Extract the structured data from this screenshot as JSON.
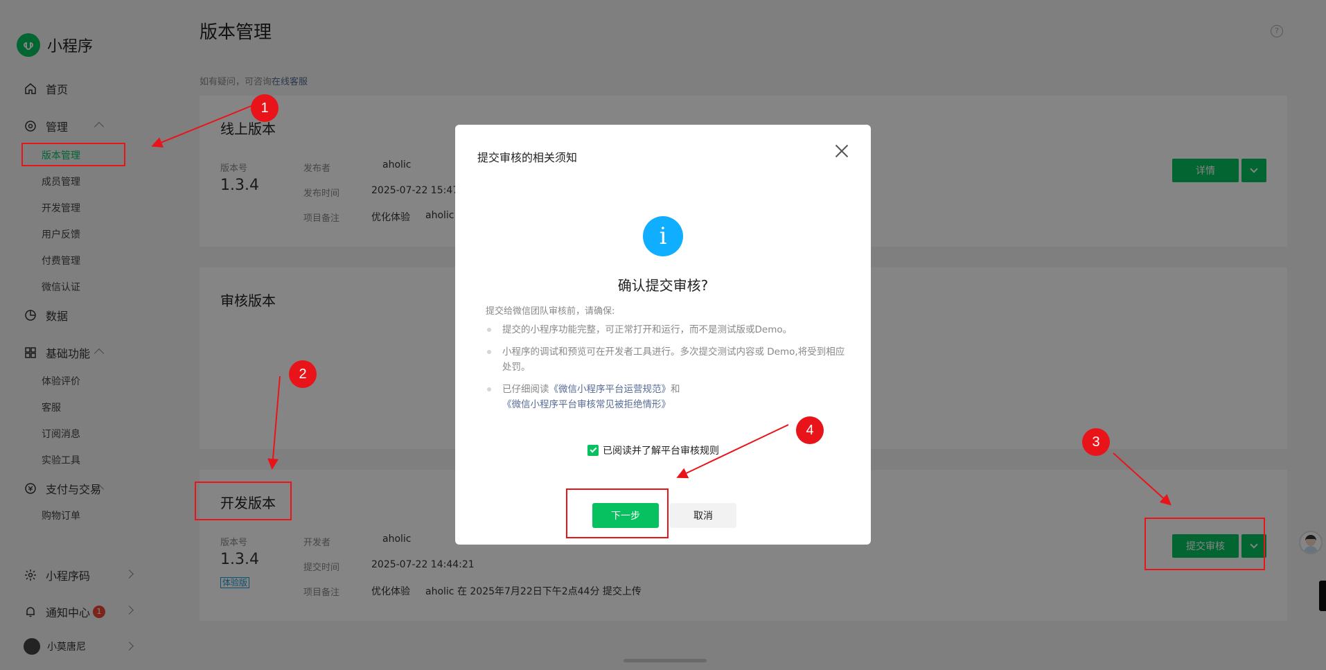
{
  "app": {
    "name": "小程序"
  },
  "sidebar": {
    "home": "首页",
    "manage": {
      "label": "管理",
      "items": [
        "版本管理",
        "成员管理",
        "开发管理",
        "用户反馈",
        "付费管理",
        "微信认证"
      ]
    },
    "data": "数据",
    "basic": {
      "label": "基础功能",
      "items": [
        "体验评价",
        "客服",
        "订阅消息",
        "实验工具"
      ]
    },
    "pay": {
      "label": "支付与交易",
      "items": [
        "购物订单"
      ]
    },
    "qrcode": "小程序码",
    "notify": {
      "label": "通知中心",
      "count": "1"
    },
    "user": "小莫唐尼"
  },
  "page": {
    "title": "版本管理",
    "hint_prefix": "如有疑问，可咨询",
    "hint_link": "在线客服"
  },
  "online": {
    "title": "线上版本",
    "version_label": "版本号",
    "version": "1.3.4",
    "publisher_label": "发布者",
    "publisher": "aholic",
    "time_label": "发布时间",
    "time": "2025-07-22 15:47:",
    "note_label": "项目备注",
    "note": "优化体验",
    "note_by": "aholic",
    "detail_btn": "详情"
  },
  "review": {
    "title": "审核版本"
  },
  "dev": {
    "title": "开发版本",
    "version_label": "版本号",
    "version": "1.3.4",
    "tag": "体验版",
    "dev_label": "开发者",
    "developer": "aholic",
    "time_label": "提交时间",
    "time": "2025-07-22 14:44:21",
    "note_label": "项目备注",
    "note": "优化体验",
    "note_detail": "aholic 在 2025年7月22日下午2点44分 提交上传",
    "submit_btn": "提交审核"
  },
  "modal": {
    "title": "提交审核的相关须知",
    "heading": "确认提交审核?",
    "intro": "提交给微信团队审核前，请确保:",
    "rule1": "提交的小程序功能完整，可正常打开和运行，而不是测试版或Demo。",
    "rule2": "小程序的调试和预览可在开发者工具进行。多次提交测试内容或 Demo,将受到相应处罚。",
    "rule3_prefix": "已仔细阅读",
    "rule3_link1": "《微信小程序平台运营规范》",
    "rule3_and": "和",
    "rule3_link2": "《微信小程序平台审核常见被拒绝情形》",
    "agree": "已阅读并了解平台审核规则",
    "next": "下一步",
    "cancel": "取消"
  },
  "annotations": [
    "1",
    "2",
    "3",
    "4"
  ],
  "colors": {
    "accent": "#07c160",
    "annotation": "#e8141a",
    "info": "#10aeff",
    "link": "#576b95"
  }
}
